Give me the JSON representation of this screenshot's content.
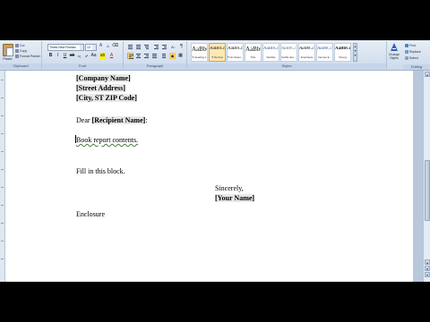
{
  "ribbon": {
    "clipboard": {
      "paste_label": "Paste",
      "cut_label": "Cut",
      "copy_label": "Copy",
      "format_painter_label": "Format Painter",
      "group_label": "Clipboard"
    },
    "font": {
      "font_name": "Times New Roman",
      "font_size": "12",
      "bold_label": "B",
      "italic_label": "I",
      "underline_label": "U",
      "group_label": "Font"
    },
    "paragraph": {
      "group_label": "Paragraph"
    },
    "styles": {
      "group_label": "Styles",
      "tiles": [
        {
          "sample": "AaBbC",
          "name": "¶ Heading 1"
        },
        {
          "sample": "AaBbCcI",
          "name": "¶ Normal"
        },
        {
          "sample": "AaBbCcI",
          "name": "¶ No Spaci..."
        },
        {
          "sample": "AaBbC",
          "name": "Title"
        },
        {
          "sample": "AaBbCcI",
          "name": "Subtitle"
        },
        {
          "sample": "AaBbCcI",
          "name": "Subtle Em..."
        },
        {
          "sample": "AaBbCcI",
          "name": "Emphasis"
        },
        {
          "sample": "AaBbCcI",
          "name": "Intense E..."
        },
        {
          "sample": "AaBbCcI",
          "name": "Strong"
        }
      ],
      "change_styles_label": "Change Styles"
    },
    "editing": {
      "find_label": "Find",
      "replace_label": "Replace",
      "select_label": "Select",
      "group_label": "Editing"
    }
  },
  "document": {
    "company_name": "[Company Name]",
    "street_address": "[Street Address]",
    "city_line": "[City, ST  ZIP Code]",
    "salutation_prefix": "Dear ",
    "recipient_name": "[Recipient Name]",
    "salutation_suffix": ":",
    "body_text": "Book report contents.",
    "fill_text": "Fill in this block.",
    "closing": "Sincerely,",
    "your_name": "[Your Name]",
    "enclosure": "Enclosure"
  },
  "colors": {
    "ribbon_bg": "#cddaeb",
    "selected_style": "#fde8b5",
    "accent_border": "#e3a238"
  }
}
